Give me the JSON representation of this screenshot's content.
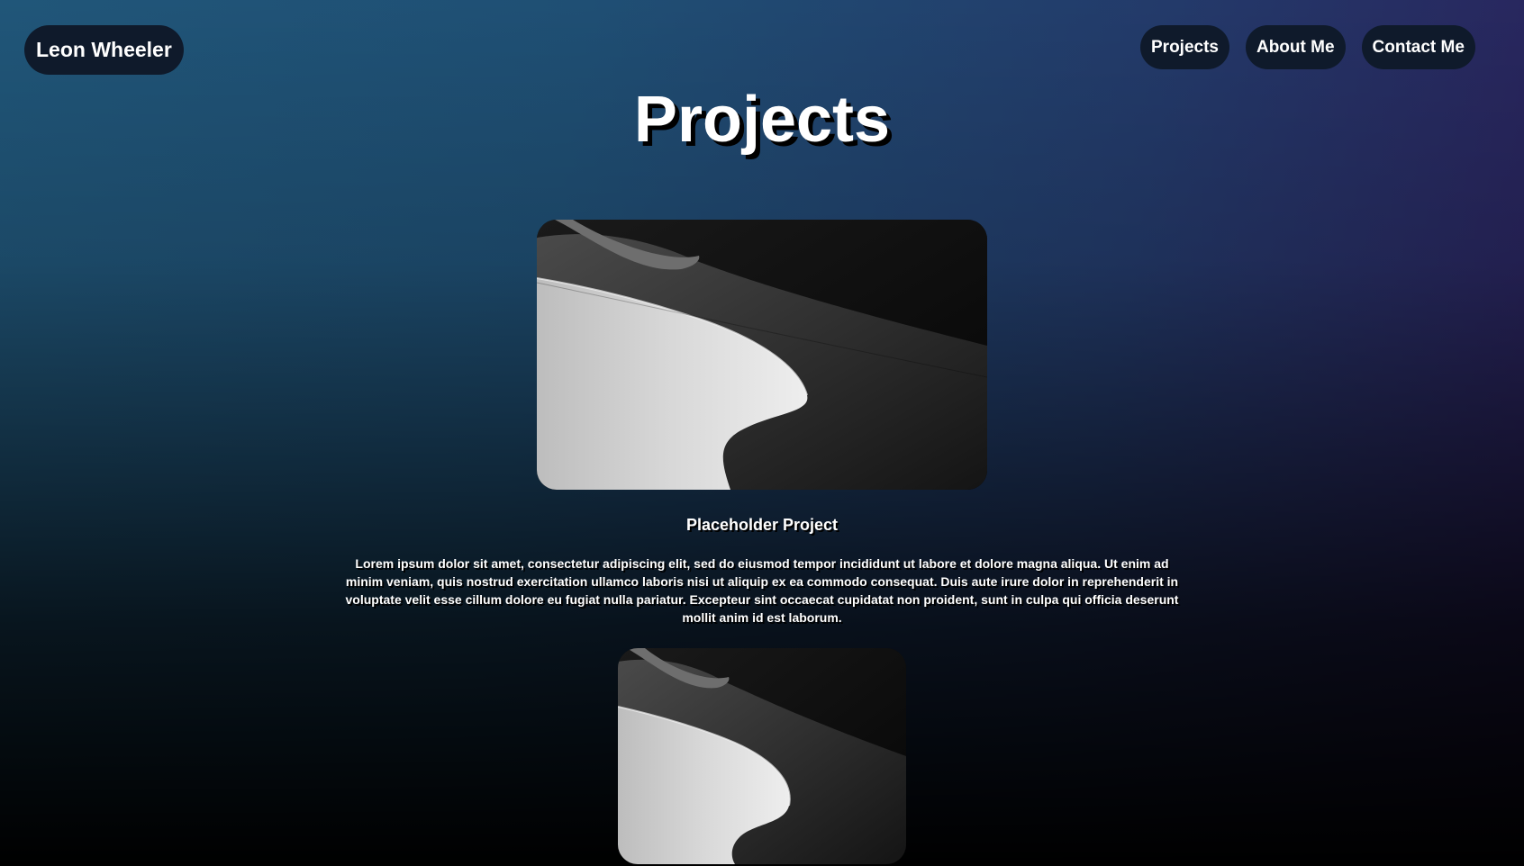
{
  "header": {
    "brand": "Leon Wheeler",
    "nav": [
      {
        "label": "Projects"
      },
      {
        "label": "About Me"
      },
      {
        "label": "Contact Me"
      }
    ]
  },
  "main": {
    "title": "Projects",
    "projects": [
      {
        "title": "Placeholder Project",
        "description": "Lorem ipsum dolor sit amet, consectetur adipiscing elit, sed do eiusmod tempor incididunt ut labore et dolore magna aliqua. Ut enim ad minim veniam, quis nostrud exercitation ullamco laboris nisi ut aliquip ex ea commodo consequat. Duis aute irure dolor in reprehenderit in voluptate velit esse cillum dolore eu fugiat nulla pariatur. Excepteur sint occaecat cupidatat non proident, sunt in culpa qui officia deserunt mollit anim id est laborum."
      }
    ]
  },
  "colors": {
    "pill_background": "#0f1a2b",
    "gradient_top_left": "#205679",
    "gradient_top_right": "#2a1f5a",
    "gradient_bottom": "#000000"
  }
}
